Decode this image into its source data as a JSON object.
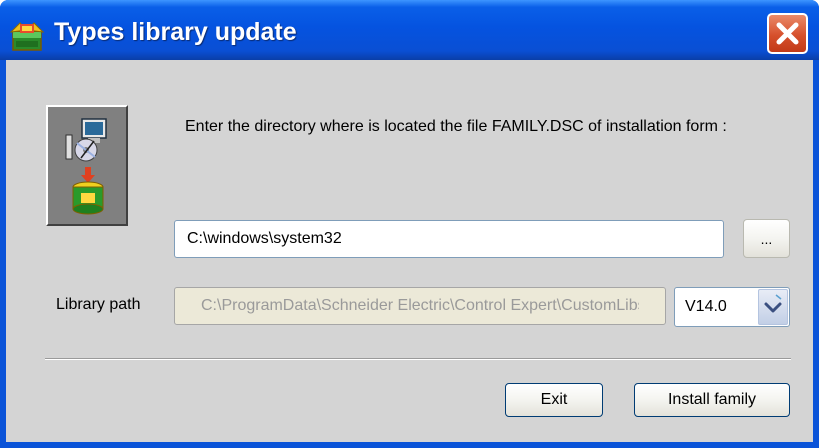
{
  "window": {
    "title": "Types library update",
    "title_icon": "library-package-icon",
    "close_icon": "close-x-icon"
  },
  "colors": {
    "titlebar": "#0553e0",
    "client_bg": "#d4d4d4",
    "close_button": "#d6502c",
    "button_border": "#003c74"
  },
  "dialog": {
    "instruction": "Enter the directory where is located the file FAMILY.DSC of installation form :",
    "logo_icon": "computer-cd-install-icon",
    "directory_value": "C:\\windows\\system32",
    "browse_label": "...",
    "library_label": "Library path",
    "library_value": "C:\\ProgramData\\Schneider Electric\\Control Expert\\CustomLibset",
    "version_selected": "V14.0",
    "dropdown_icon": "chevron-down-icon",
    "exit_label": "Exit",
    "install_label": "Install family"
  }
}
